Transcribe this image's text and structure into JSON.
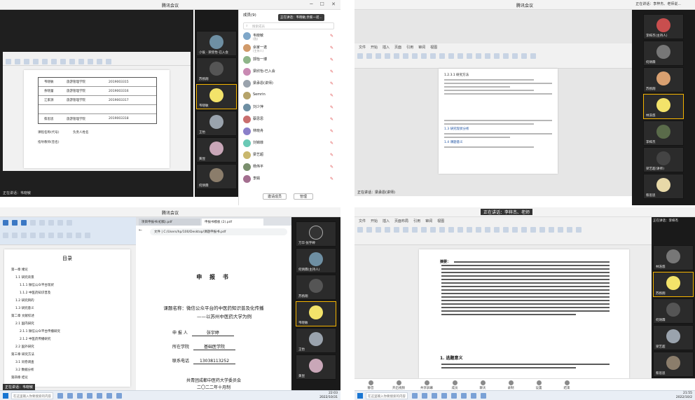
{
  "q1": {
    "window_title": "腾讯会议",
    "status_top": "正在讲话：",
    "speaking_banner": "正在讲话：韦晓敏,佘家一诺...",
    "members_title": "成员(9)",
    "search_placeholder": "搜索成员",
    "members": [
      {
        "name": "韦晓敏",
        "sub": "(我)"
      },
      {
        "name": "佘家一诺",
        "sub": "(主持人)"
      },
      {
        "name": "郭怡一博",
        "sub": ""
      },
      {
        "name": "梁欣怡-已入会",
        "sub": ""
      },
      {
        "name": "梁承恩(讲师)",
        "sub": ""
      },
      {
        "name": "Semrin",
        "sub": ""
      },
      {
        "name": "刘少萍",
        "sub": ""
      },
      {
        "name": "蔡思思",
        "sub": ""
      },
      {
        "name": "林晓舟",
        "sub": ""
      },
      {
        "name": "刘锦菲",
        "sub": ""
      },
      {
        "name": "梁艺超",
        "sub": ""
      },
      {
        "name": "杨伟平",
        "sub": ""
      },
      {
        "name": "李娟",
        "sub": ""
      }
    ],
    "buttons": {
      "invite": "邀请成员",
      "manage": "管理"
    },
    "tiles": [
      "小侯 · 梁欣怡-已入会",
      "苏扬翔",
      "韦晓敏",
      "王怡",
      "黄昆",
      "何炳霖"
    ],
    "table_rows": [
      [
        "韦晓敏",
        "旅游管理学院",
        "2019003315"
      ],
      [
        "余晓蕾",
        "旅游管理学院",
        "2019003316"
      ],
      [
        "江家源",
        "旅游管理学院",
        "2019003317"
      ],
      [
        "",
        "",
        ""
      ],
      [
        "蔡思思",
        "旅游管理学院",
        "2019003318"
      ]
    ],
    "form_labels": {
      "row1": "课程名称(代号)",
      "row2": "负责人姓名",
      "row3": "指导教师(签名)"
    },
    "footer_speaker": "正在讲话：韦晓敏"
  },
  "q2": {
    "window_title": "腾讯会议",
    "speaker_top": "正在讲话：李梓杰、老师说...",
    "tiles": [
      "李梓杰(主持人)",
      "何炳霖",
      "苏扬翔",
      "林浩悠",
      "李梓杰",
      "梁艺超(讲师)",
      "蔡思思"
    ],
    "doc_heading_1": "1.2.3.1 研究方法",
    "doc_section": "1.3 研究现状分析",
    "doc_section_2": "1.4 课题意义",
    "footer_speaker": "正在讲话：梁承恩(讲师)"
  },
  "q3": {
    "window_title": "腾讯会议",
    "browser_tabs": [
      "项目申报书(初稿).pdf",
      "申报书模板 (2).pdf"
    ],
    "address": "文件 | C:/Users/hp/100/Desktop/课题申报书.pdf",
    "cover_title": "申 报 书",
    "project_title_line1": "课题名称：微信公众平台的中医药知识普及化传播",
    "project_title_line2": "——以苏州中医药大学为例",
    "applicant_label": "申 报 人",
    "applicant_value": "张宇婷",
    "college_label": "所在学院",
    "college_value": "基础医学院",
    "phone_label": "联系电话",
    "phone_value": "13038113252",
    "footer_line1": "共青团成都中医药大学委员会",
    "footer_line2": "二〇二二年十月制",
    "toc_title": "目录",
    "toc": [
      "第一章 绪论",
      "1.1 研究背景",
      "1.1.1 微信公众平台现状",
      "1.1.2 中医药知识普及",
      "1.2 研究目的",
      "1.3 研究意义",
      "第二章 文献综述",
      "2.1 国内研究",
      "2.1.1 微信公众平台传播研究",
      "2.1.2 中医药传播研究",
      "2.2 国外研究",
      "第三章 研究方法",
      "3.1 问卷调查",
      "3.2 数据分析",
      "第四章 结论"
    ],
    "tiles": [
      "万华·张宇婷",
      "何炳霖(主持人)",
      "苏扬翔",
      "韦晓敏",
      "王怡",
      "黄昆",
      "何炳霖"
    ],
    "taskbar_search": "在这里输入你要搜索的内容",
    "time": "22:03",
    "date": "2022/10/31",
    "footer_speaker": "正在讲话：韦晓敏"
  },
  "q4": {
    "window_title": "正在讲话：李梓杰、老师",
    "top_right": "正在讲话：李梓杰",
    "tiles": [
      "李梓杰(主持人)",
      "林浩悠",
      "苏扬翔",
      "何炳霖",
      "梁艺超",
      "蔡思思"
    ],
    "doc_heading": "1. 选题意义",
    "doc_abstract_label": "摘要：",
    "toolbar": [
      "静音",
      "开启视频",
      "共享屏幕",
      "成员",
      "聊天",
      "录制",
      "设置",
      "结束"
    ],
    "taskbar_search": "在这里输入你要搜索的内容",
    "time": "21:55",
    "date": "2022/10/2",
    "colors": {
      "accent": "#f5b400",
      "meeting_dark": "#1f1f1f",
      "taskbar": "#e9eef5"
    }
  }
}
